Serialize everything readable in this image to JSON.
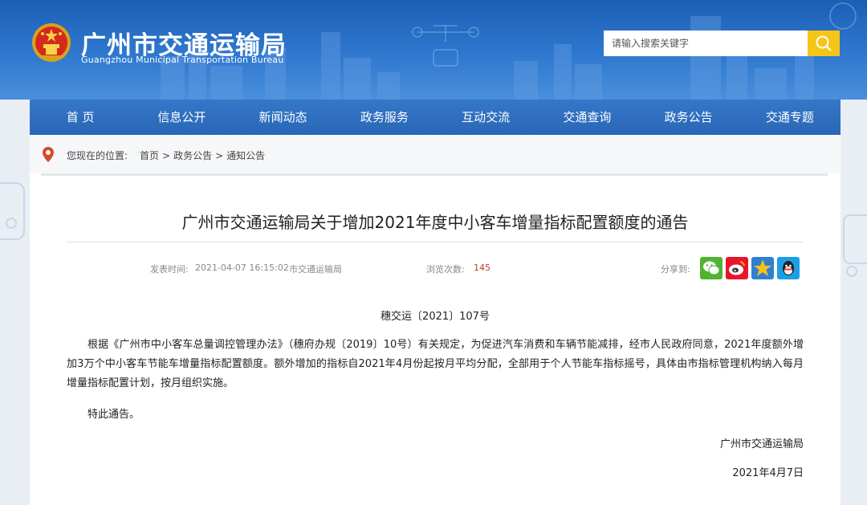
{
  "header": {
    "site_name_cn": "广州市交通运输局",
    "site_name_en": "Guangzhou Municipal Transportation Bureau",
    "search": {
      "placeholder": "请输入搜索关键字"
    },
    "icons": {
      "emblem": "national-emblem-icon",
      "search": "search-icon"
    },
    "colors": {
      "banner": "#2f78cf",
      "search_button": "#f5c518"
    }
  },
  "nav": {
    "items": [
      {
        "label": "首 页"
      },
      {
        "label": "信息公开"
      },
      {
        "label": "新闻动态"
      },
      {
        "label": "政务服务"
      },
      {
        "label": "互动交流"
      },
      {
        "label": "交通查询"
      },
      {
        "label": "政务公告"
      },
      {
        "label": "交通专题"
      }
    ]
  },
  "breadcrumb": {
    "label": "您现在的位置:",
    "items": [
      "首页",
      "政务公告",
      "通知公告"
    ],
    "separator": ">",
    "icon": "location-pin-icon"
  },
  "article": {
    "title": "广州市交通运输局关于增加2021年度中小客车增量指标配置额度的通告",
    "meta": {
      "published_label": "发表时间:",
      "published_value": "2021-04-07 16:15:02",
      "source": "市交通运输局",
      "views_label": "浏览次数:",
      "views_value": "145",
      "share_label": "分享到:"
    },
    "share_icons": [
      "wechat-icon",
      "weibo-icon",
      "qzone-icon",
      "qq-icon"
    ],
    "doc_number": "穗交运〔2021〕107号",
    "body": "根据《广州市中小客车总量调控管理办法》（穗府办规〔2019〕10号）有关规定，为促进汽车消费和车辆节能减排，经市人民政府同意，2021年度额外增加3万个中小客车节能车增量指标配置额度。额外增加的指标自2021年4月份起按月平均分配，全部用于个人节能车指标摇号，具体由市指标管理机构纳入每月增量指标配置计划，按月组织实施。",
    "closing": "特此通告。",
    "signature": "广州市交通运输局",
    "date": "2021年4月7日"
  }
}
